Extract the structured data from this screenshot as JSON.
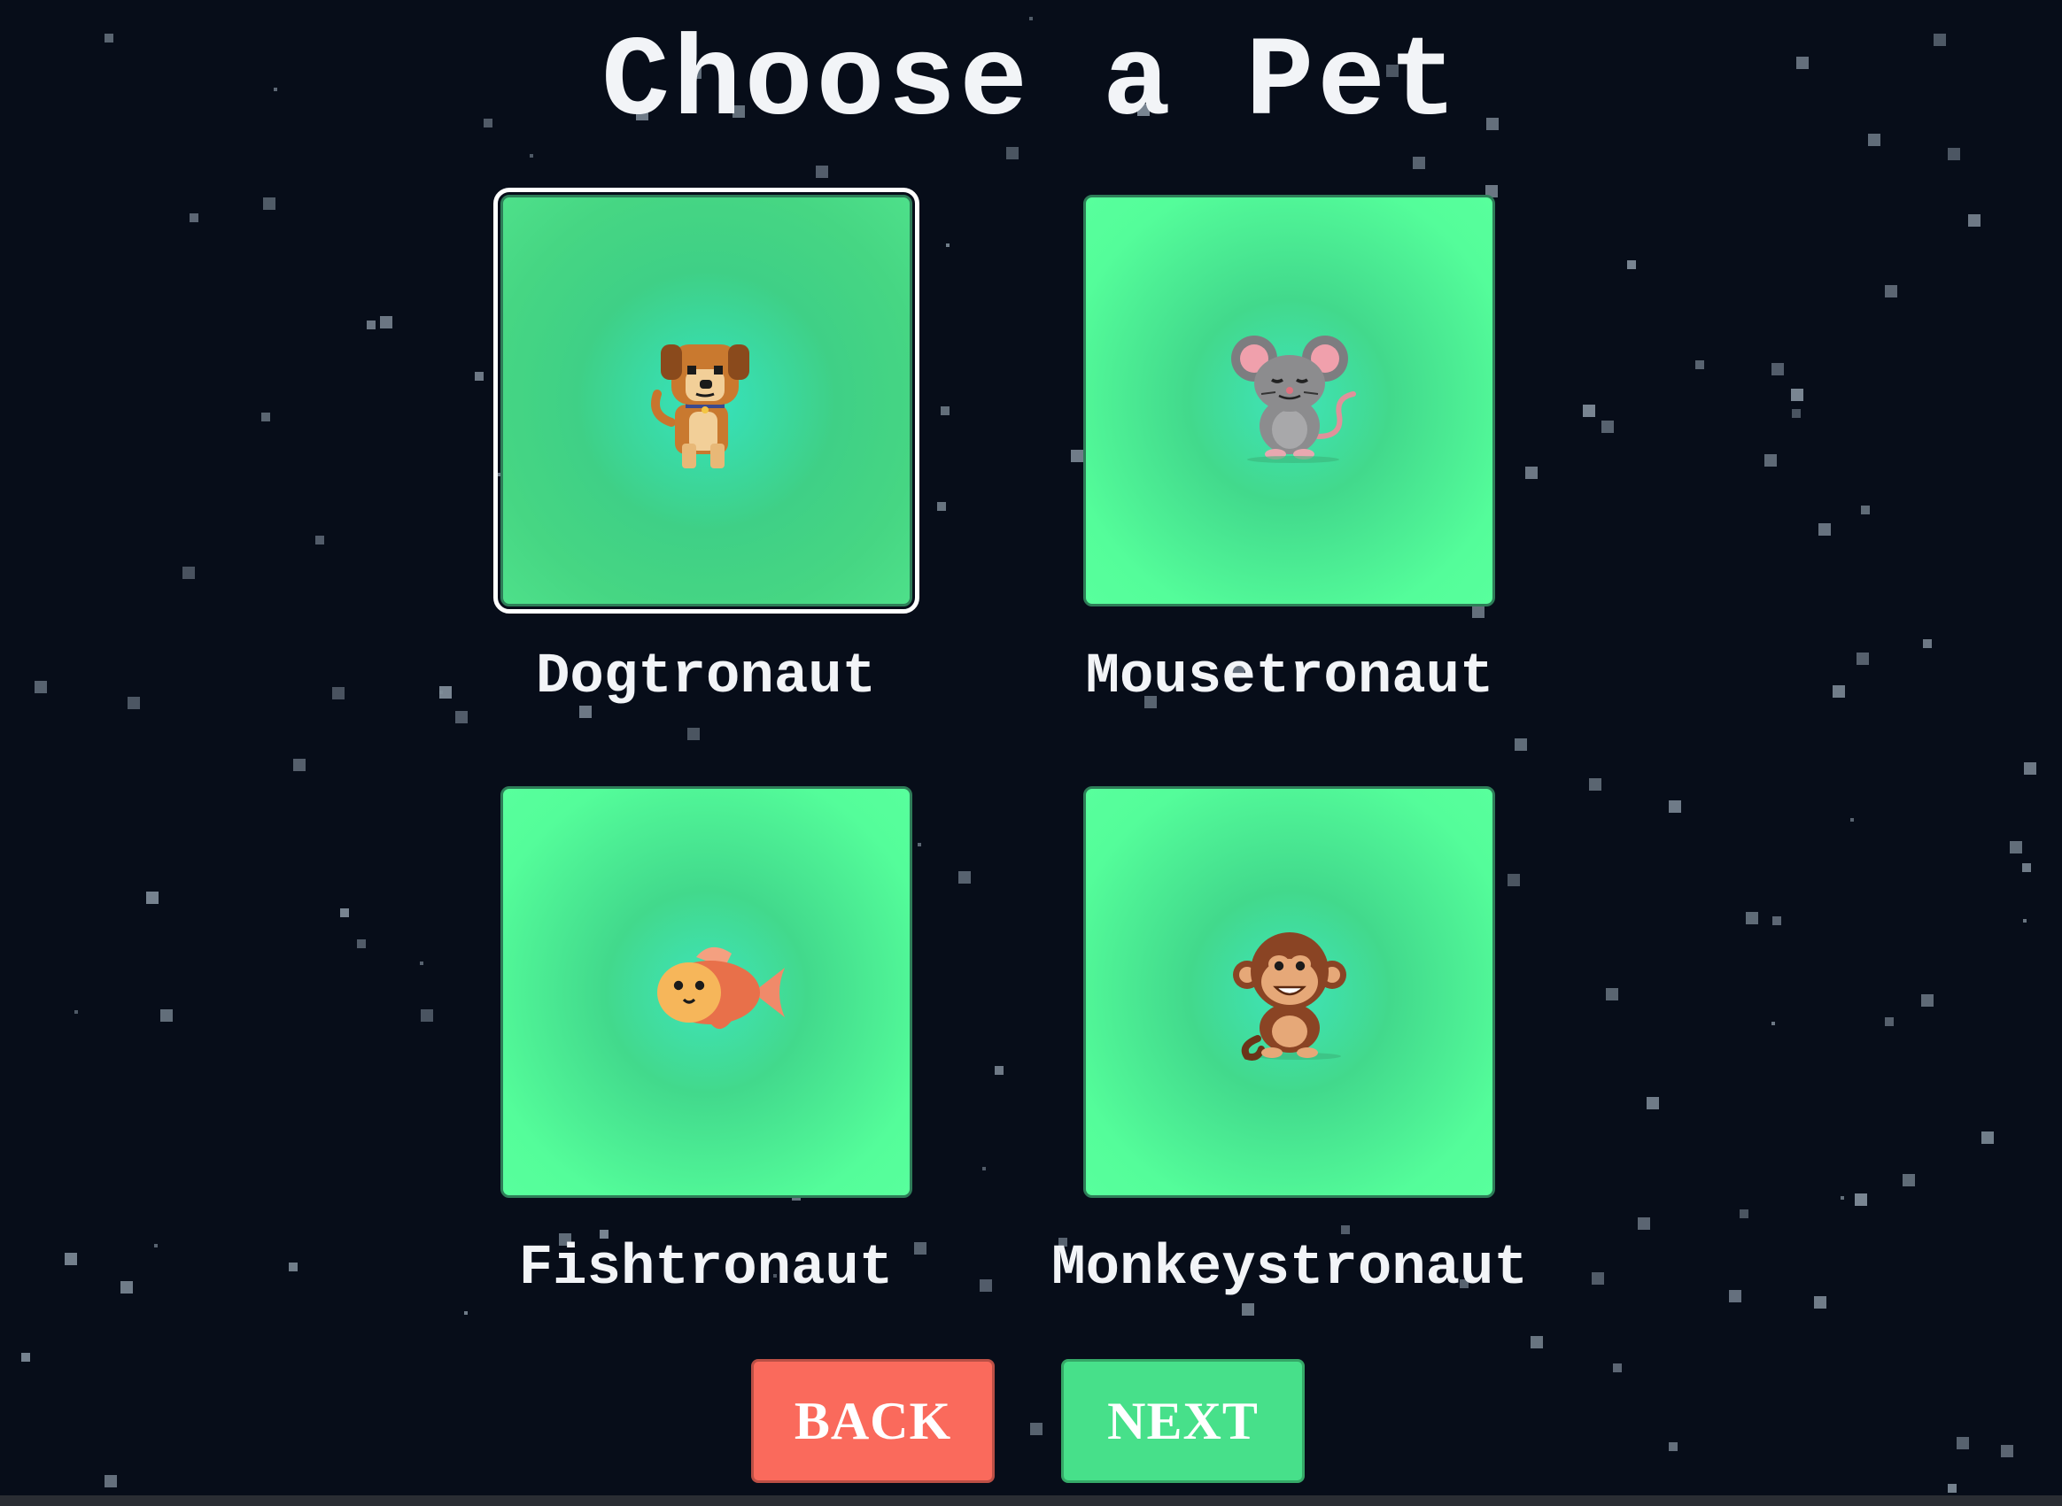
{
  "screen": {
    "title": "Choose a Pet"
  },
  "pets": [
    {
      "name": "Dogtronaut",
      "icon": "dog-icon",
      "selected": true
    },
    {
      "name": "Mousetronaut",
      "icon": "mouse-icon",
      "selected": false
    },
    {
      "name": "Fishtronaut",
      "icon": "fish-icon",
      "selected": false
    },
    {
      "name": "Monkeystronaut",
      "icon": "monkey-icon",
      "selected": false
    }
  ],
  "buttons": {
    "back_label": "BACK",
    "next_label": "NEXT"
  },
  "colors": {
    "background": "#070d19",
    "card_green": "#54fd9a",
    "back_button": "#fa6a5c",
    "next_button": "#47e08a",
    "selected_outline": "#ffffff"
  }
}
